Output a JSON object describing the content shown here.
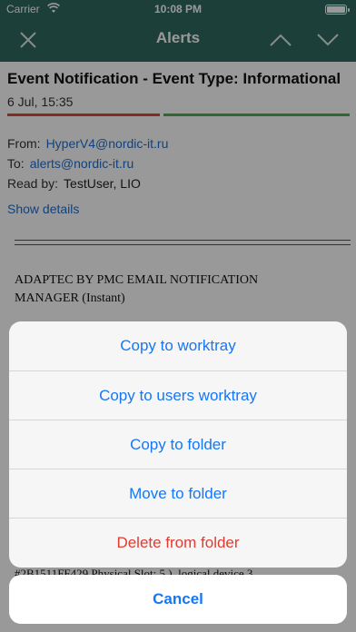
{
  "status_bar": {
    "carrier": "Carrier",
    "time": "10:08 PM",
    "battery_level": 1.0
  },
  "nav": {
    "title": "Alerts"
  },
  "message": {
    "subject": "Event Notification - Event Type: Informational",
    "date": "6 Jul, 15:35",
    "from_label": "From:",
    "from_value": "HyperV4@nordic-it.ru",
    "to_label": "To:",
    "to_value": "alerts@nordic-it.ru",
    "read_by_label": "Read by:",
    "read_by_value": "TestUser, LIO",
    "show_details": "Show details",
    "divider_text": "=========================================",
    "body_line": "ADAPTEC BY PMC EMAIL NOTIFICATION MANAGER (Instant)",
    "obscured_line": "#2B1511FF429 Physical Slot: 5.), logical device 3"
  },
  "action_sheet": {
    "items": [
      {
        "label": "Copy to worktray"
      },
      {
        "label": "Copy to users worktray"
      },
      {
        "label": "Copy to folder"
      },
      {
        "label": "Move to folder"
      },
      {
        "label": "Delete from folder"
      }
    ],
    "cancel": "Cancel"
  },
  "colors": {
    "nav_bg": "#2f6b60",
    "link": "#1f6fd0",
    "action": "#1477f8",
    "destructive": "#e23b2f",
    "bar_red": "#d84b3a",
    "bar_green": "#4caf50"
  },
  "icons": {
    "close": "close-icon",
    "up": "chevron-up-icon",
    "down": "chevron-down-icon",
    "wifi": "wifi-icon",
    "battery": "battery-icon"
  }
}
